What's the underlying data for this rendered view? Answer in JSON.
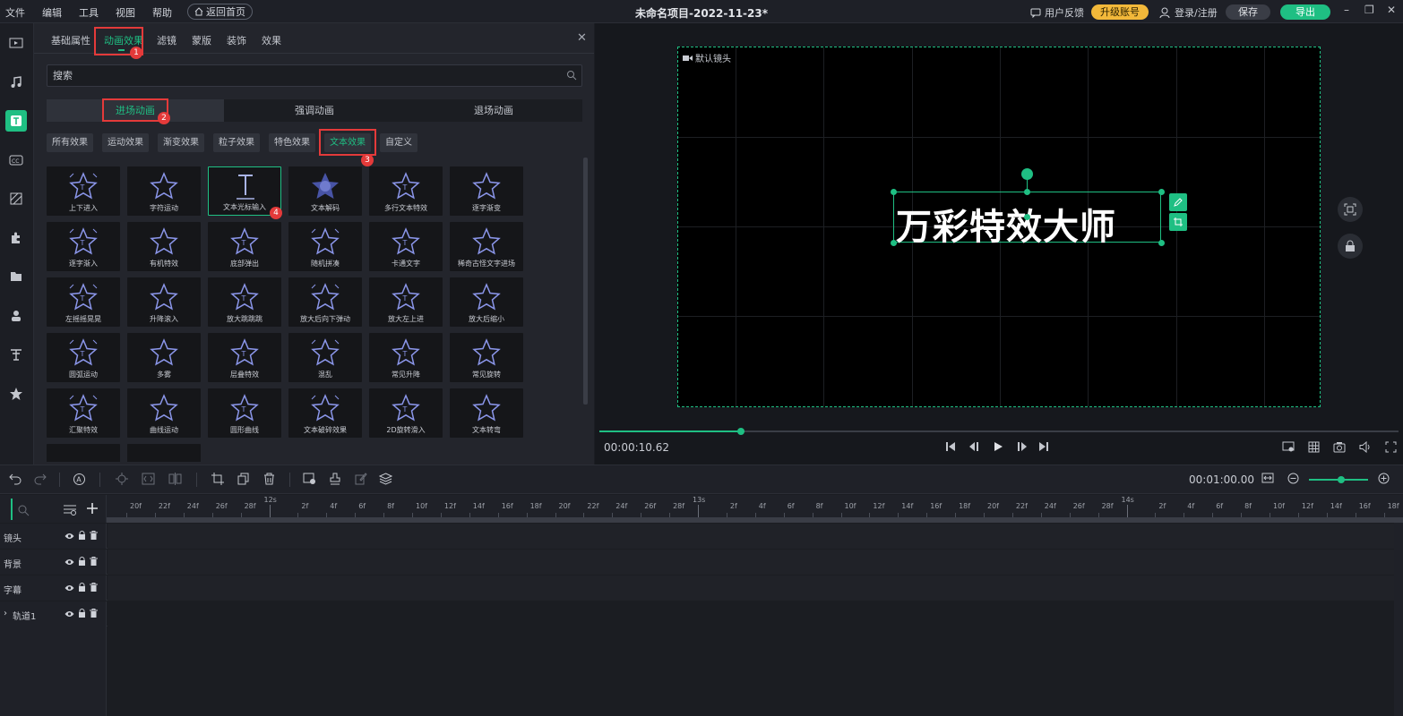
{
  "menu": [
    "文件",
    "编辑",
    "工具",
    "视图",
    "帮助"
  ],
  "home_button": "返回首页",
  "app_title": "未命名项目-2022-11-23*",
  "header": {
    "feedback": "用户反馈",
    "upgrade": "升级账号",
    "login": "登录/注册",
    "save": "保存",
    "export": "导出"
  },
  "panel": {
    "tabs": [
      "基础属性",
      "动画效果",
      "滤镜",
      "蒙版",
      "装饰",
      "效果"
    ],
    "active_tab": "动画效果",
    "search_placeholder": "搜索",
    "anim_tabs": [
      "进场动画",
      "强调动画",
      "退场动画"
    ],
    "active_anim_tab": "进场动画",
    "categories": [
      "所有效果",
      "运动效果",
      "渐变效果",
      "粒子效果",
      "特色效果",
      "文本效果",
      "自定义"
    ],
    "active_category": "文本效果",
    "effects": [
      "上下进入",
      "字符运动",
      "文本光标输入",
      "文本解码",
      "多行文本特效",
      "逐字渐变",
      "逐字渐入",
      "有机特效",
      "底部弹出",
      "随机拼凑",
      "卡通文字",
      "稀奇古怪文字进场",
      "左摇摇晃晃",
      "升降滚入",
      "放大跳跳跳",
      "放大后向下弹动",
      "放大左上进",
      "放大后缩小",
      "圆弧运动",
      "多雾",
      "层叠特效",
      "混乱",
      "常见升降",
      "常见旋转",
      "汇聚特效",
      "曲线运动",
      "圆形曲线",
      "文本破碎效果",
      "2D旋转滑入",
      "文本转弯"
    ],
    "selected_effect": "文本光标输入",
    "annotations": [
      "1",
      "2",
      "3",
      "4"
    ]
  },
  "preview": {
    "camera_label": "默认镜头",
    "title_text": "万彩特效大师",
    "current_time": "00:00:10.62",
    "progress": 0.177
  },
  "toolbar": {
    "duration": "00:01:00.00",
    "zoom_level": 0.55
  },
  "timeline": {
    "ruler_major": [
      "12s",
      "13s",
      "14s"
    ],
    "ruler_minor": [
      "20f",
      "22f",
      "24f",
      "26f",
      "28f",
      "2f",
      "4f",
      "6f",
      "8f",
      "10f",
      "12f",
      "14f",
      "16f",
      "18f",
      "20f",
      "22f",
      "24f",
      "26f",
      "28f",
      "2f",
      "4f",
      "6f",
      "8f",
      "10f",
      "12f",
      "14f",
      "16f",
      "18f",
      "20f",
      "22f",
      "24f",
      "26f",
      "28f",
      "2f",
      "4f",
      "6f",
      "8f",
      "10f",
      "12f",
      "14f",
      "16f",
      "18f"
    ],
    "tracks": [
      "镜头",
      "背景",
      "字幕",
      "轨道1"
    ]
  },
  "colors": {
    "accent": "#1fbf83",
    "upgrade": "#f2b83a",
    "annotation": "#e43a3a"
  }
}
